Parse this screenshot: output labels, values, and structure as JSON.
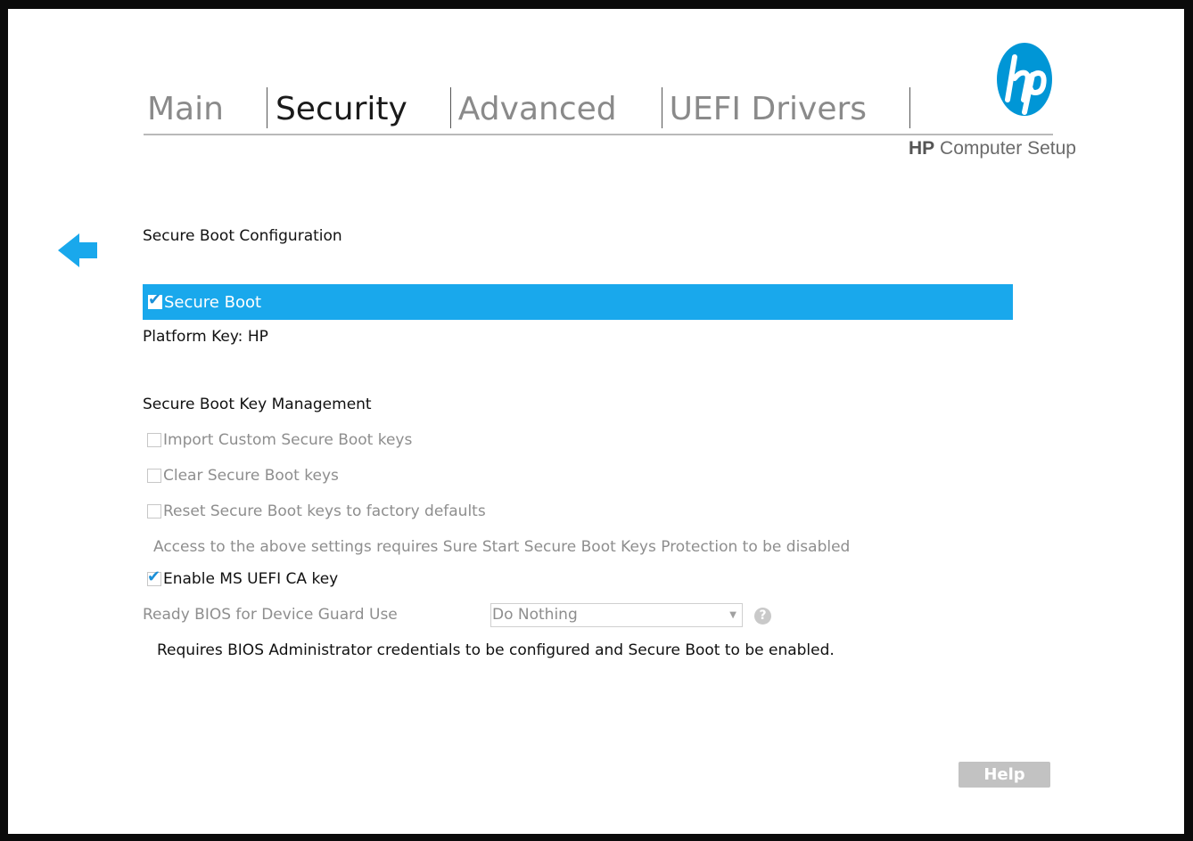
{
  "tabs": [
    {
      "label": "Main",
      "active": false
    },
    {
      "label": "Security",
      "active": true
    },
    {
      "label": "Advanced",
      "active": false
    },
    {
      "label": "UEFI Drivers",
      "active": false
    }
  ],
  "brand": {
    "bold": "HP",
    "rest": "Computer Setup"
  },
  "page": {
    "section_title": "Secure Boot Configuration",
    "secure_boot": {
      "label": "Secure Boot",
      "checked": true
    },
    "platform_key": "Platform Key: HP",
    "key_mgmt_title": "Secure Boot Key Management",
    "import_keys": {
      "label": "Import Custom Secure Boot keys",
      "checked": false,
      "enabled": false
    },
    "clear_keys": {
      "label": "Clear Secure Boot keys",
      "checked": false,
      "enabled": false
    },
    "reset_keys": {
      "label": "Reset Secure Boot keys to factory defaults",
      "checked": false,
      "enabled": false
    },
    "access_note": "Access to the above settings requires Sure Start Secure Boot Keys Protection to be disabled",
    "ms_uefi_ca": {
      "label": "Enable MS UEFI CA key",
      "checked": true
    },
    "device_guard": {
      "label": "Ready BIOS for Device Guard Use",
      "value": "Do Nothing"
    },
    "requirement_note": "Requires BIOS Administrator credentials to be configured and Secure Boot to be enabled."
  },
  "footer": {
    "help_label": "Help"
  },
  "colors": {
    "accent": "#19a8ec",
    "logo": "#0096d6"
  },
  "icons": {
    "back": "back-arrow-icon",
    "logo": "hp-logo-icon",
    "help": "question-circle-icon",
    "checkbox_tick": "checkmark-icon"
  }
}
